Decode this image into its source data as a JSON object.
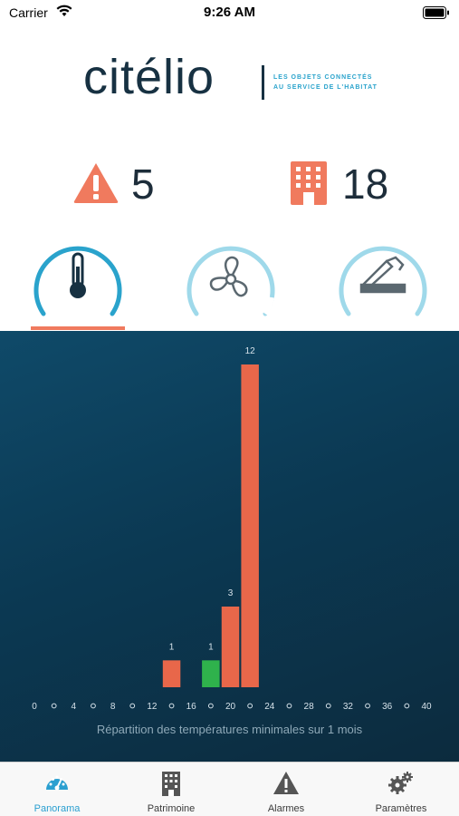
{
  "status_bar": {
    "carrier": "Carrier",
    "time": "9:26 AM"
  },
  "brand": {
    "name": "citélio",
    "tagline_line1": "LES OBJETS CONNECTÉS",
    "tagline_line2": "AU SERVICE DE L'HABITAT",
    "accent": "#2aa3cc",
    "dark": "#173142"
  },
  "stats": {
    "alarms": "5",
    "buildings": "18",
    "icon_color": "#f07a5e"
  },
  "gauges": [
    {
      "name": "thermometer-icon",
      "active": true
    },
    {
      "name": "fan-icon",
      "active": false
    },
    {
      "name": "window-icon",
      "active": false
    }
  ],
  "chart_data": {
    "type": "bar",
    "title": "",
    "xlabel": "Répartition des températures minimales sur 1 mois",
    "ylabel": "",
    "x_ticks": [
      "0",
      "4",
      "8",
      "12",
      "16",
      "20",
      "24",
      "28",
      "32",
      "36",
      "40"
    ],
    "xlim": [
      0,
      40
    ],
    "ylim": [
      0,
      12
    ],
    "grid": false,
    "bars": [
      {
        "x": 14,
        "value": 1,
        "label": "1",
        "color": "#e8674a"
      },
      {
        "x": 18,
        "value": 1,
        "label": "1",
        "color": "#2fb24c"
      },
      {
        "x": 20,
        "value": 3,
        "label": "3",
        "color": "#e8674a"
      },
      {
        "x": 22,
        "value": 12,
        "label": "12",
        "color": "#e8674a"
      }
    ]
  },
  "tabs": [
    {
      "label": "Panorama",
      "icon": "speedometer-icon",
      "active": true
    },
    {
      "label": "Patrimoine",
      "icon": "building-icon",
      "active": false
    },
    {
      "label": "Alarmes",
      "icon": "warning-icon",
      "active": false
    },
    {
      "label": "Paramètres",
      "icon": "gears-icon",
      "active": false
    }
  ],
  "colors": {
    "tab_active": "#2a9fd0",
    "gauge_ring": "#2aa3cc",
    "gauge_ring_light": "#9fd9ea"
  }
}
